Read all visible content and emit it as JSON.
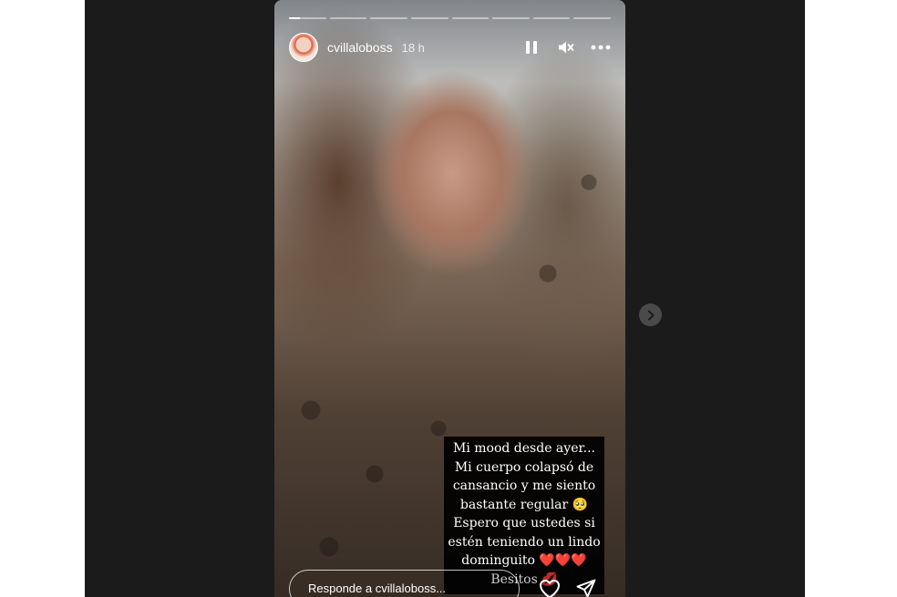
{
  "story": {
    "username": "cvillaloboss",
    "time_ago": "18 h",
    "progress": {
      "segments": 8,
      "current_index": 0,
      "current_fill": 0.3
    },
    "caption_lines": [
      "Mi mood desde ayer...",
      "Mi cuerpo colapsó de",
      "cansancio y me siento",
      "bastante regular 🥺",
      "Espero que ustedes si",
      "estén teniendo un lindo",
      "dominguito ❤️❤️❤️",
      "Besitos 💋"
    ],
    "reply_placeholder": "Responde a cvillaloboss...",
    "icons": {
      "pause": "pause-icon",
      "mute": "mute-icon",
      "more": "more-icon",
      "like": "heart-icon",
      "share": "send-icon",
      "next": "chevron-right-icon"
    }
  },
  "colors": {
    "backdrop": "#1b1b1b",
    "page": "#ffffff",
    "caption_bg": "#000000",
    "text": "#ffffff"
  }
}
